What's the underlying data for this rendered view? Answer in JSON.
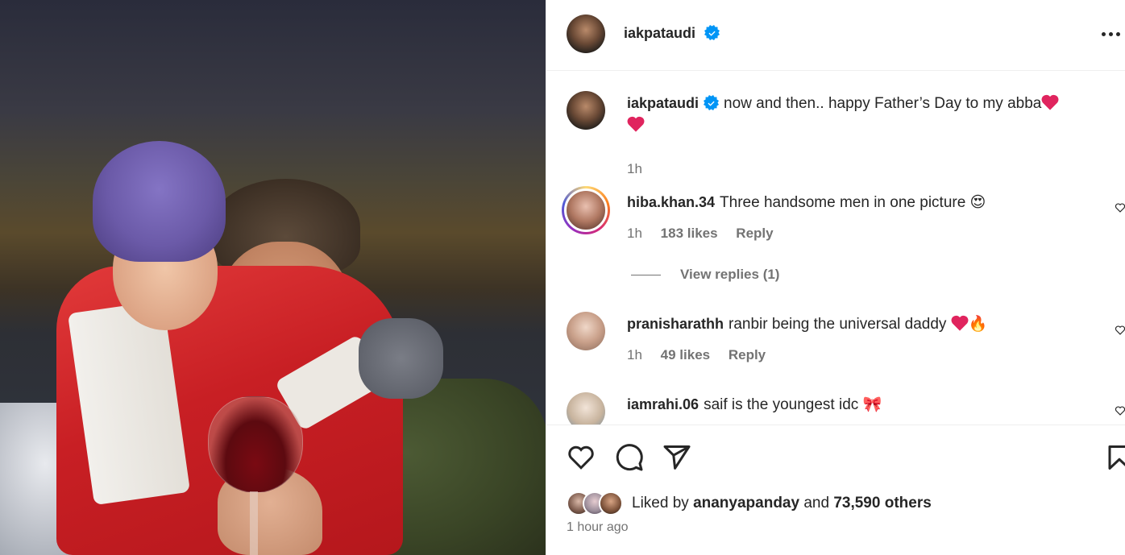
{
  "post": {
    "username": "iakpataudi",
    "verified": true,
    "caption": "now and then.. happy Father’s Day to my abba",
    "caption_time": "1h"
  },
  "comments": [
    {
      "username": "hiba.khan.34",
      "text": "Three handsome men in one picture 😍",
      "time": "1h",
      "likes": "183 likes",
      "reply": "Reply",
      "view_replies": "View replies (1)"
    },
    {
      "username": "pranisharathh",
      "text": "ranbir being the universal daddy",
      "emoji_after": "🔥",
      "time": "1h",
      "likes": "49 likes",
      "reply": "Reply"
    },
    {
      "username": "iamrahi.06",
      "text": "saif is the youngest idc 🎀"
    }
  ],
  "likes_summary": {
    "prefix": "Liked by",
    "user": "ananyapanday",
    "conjunction": "and",
    "others": "73,590 others"
  },
  "timestamp": "1 hour ago",
  "colors": {
    "verified_blue": "#0095f6",
    "heart_red": "#e0245e",
    "text_primary": "#262626",
    "text_secondary": "#737373"
  },
  "icons": [
    "heart-icon",
    "comment-icon",
    "share-icon",
    "bookmark-icon",
    "more-icon",
    "verified-icon"
  ]
}
